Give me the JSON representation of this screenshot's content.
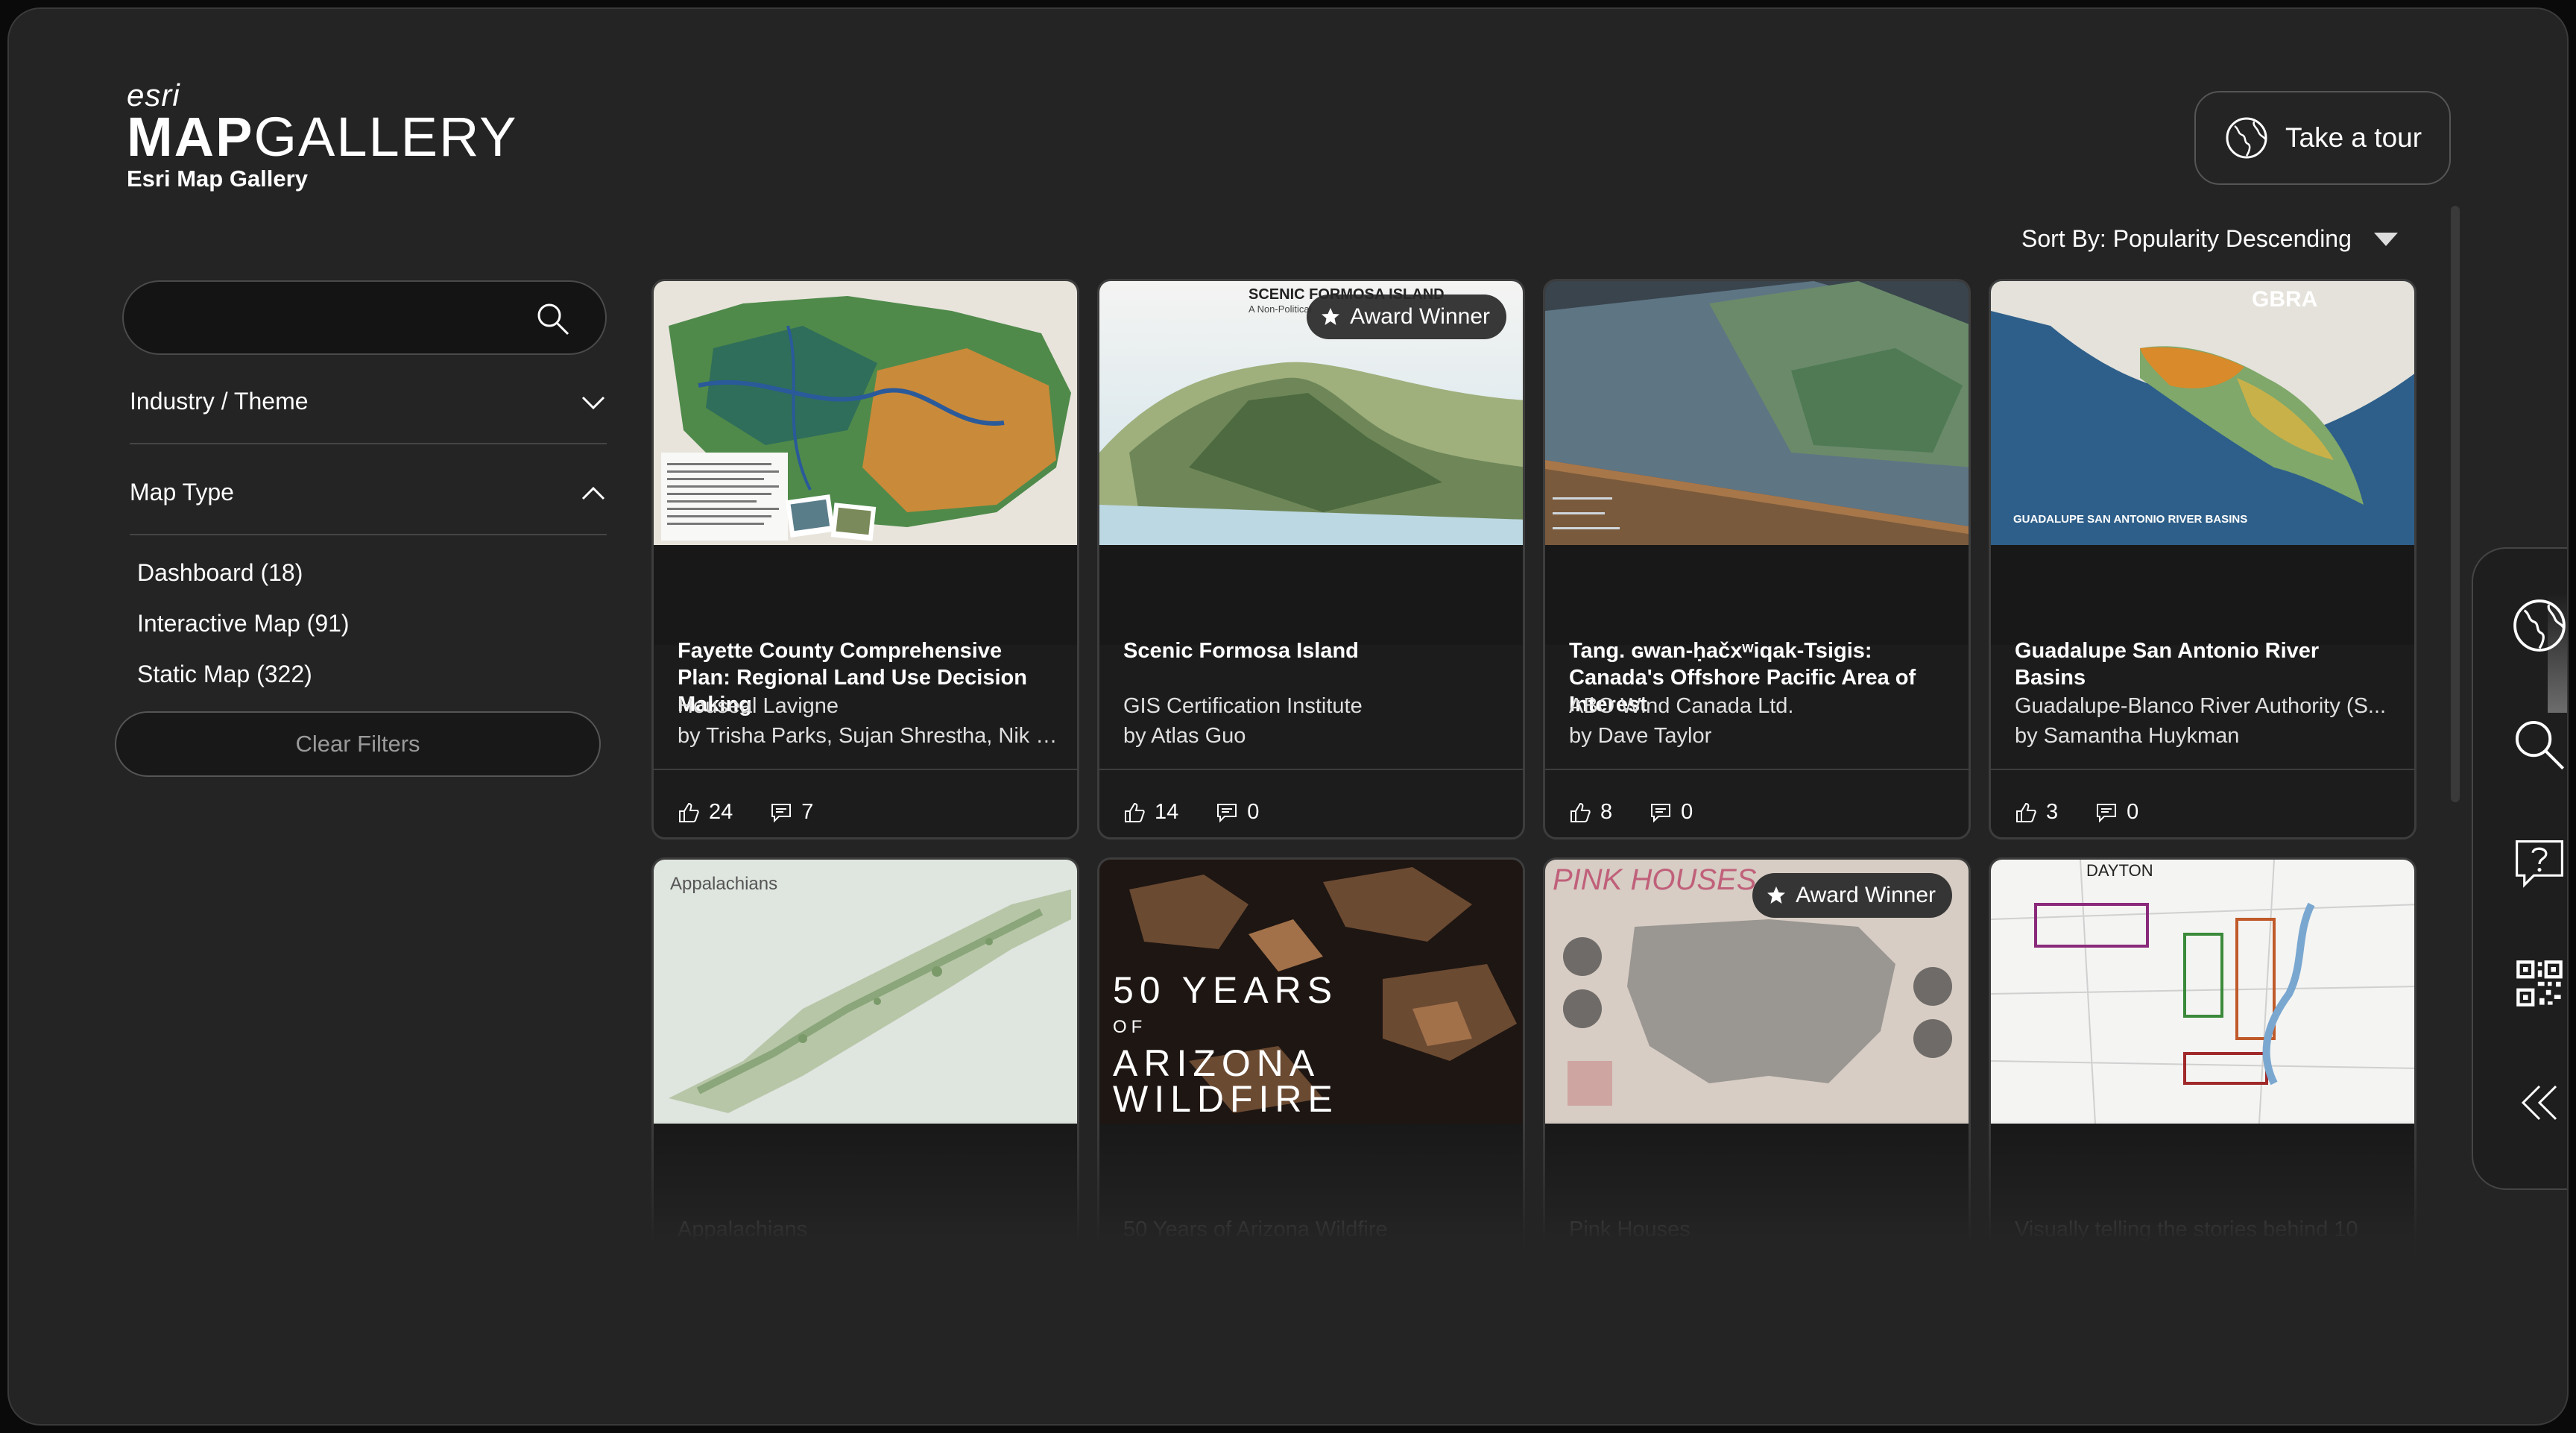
{
  "header": {
    "logo_esri": "esri",
    "logo_map": "MAP",
    "logo_gallery": "GALLERY",
    "logo_sub": "Esri Map Gallery",
    "tour_label": "Take a tour",
    "sort_label": "Sort By: Popularity Descending"
  },
  "filters": {
    "search_placeholder": "",
    "industry_label": "Industry / Theme",
    "map_type_label": "Map Type",
    "options": [
      {
        "label": "Dashboard (18)"
      },
      {
        "label": "Interactive Map (91)"
      },
      {
        "label": "Static Map (322)"
      }
    ],
    "clear_label": "Clear Filters"
  },
  "award_label": "Award Winner",
  "cards": [
    {
      "title": "Fayette County Comprehensive Plan: Regional Land Use Decision Making",
      "author": "Houseal Lavigne",
      "byline": "by Trisha Parks, Sujan Shrestha, Nik D...",
      "likes": "24",
      "comments": "7"
    },
    {
      "title": "Scenic Formosa Island",
      "author": "GIS Certification Institute",
      "byline": "by Atlas Guo",
      "likes": "14",
      "comments": "0",
      "thumb_text": "SCENIC FORMOSA ISLAND",
      "thumb_sub": "A Non-Political"
    },
    {
      "title": "Tang. ɢwan-ḥačxʷiqak-Tsigis: Canada's Offshore Pacific Area of Interest",
      "author": "ABO Wind Canada Ltd.",
      "byline": "by Dave Taylor",
      "likes": "8",
      "comments": "0"
    },
    {
      "title": "Guadalupe San Antonio River Basins",
      "author": "Guadalupe-Blanco River Authority (S...",
      "byline": "by Samantha Huykman",
      "likes": "3",
      "comments": "0",
      "thumb_text": "GBRA",
      "thumb_sub": "GUADALUPE SAN ANTONIO RIVER BASINS"
    }
  ],
  "cards_row2": [
    {
      "title": "Appalachians",
      "thumb_text": "Appalachians"
    },
    {
      "title": "50 Years of Arizona Wildfire",
      "thumb_line1": "50 YEARS",
      "thumb_line2": "OF",
      "thumb_line3": "ARIZONA",
      "thumb_line4": "WILDFIRE"
    },
    {
      "title": "Pink Houses",
      "thumb_text": "PINK HOUSES"
    },
    {
      "title": "Visually telling the stories behind 10",
      "thumb_text": "DAYTON"
    }
  ]
}
